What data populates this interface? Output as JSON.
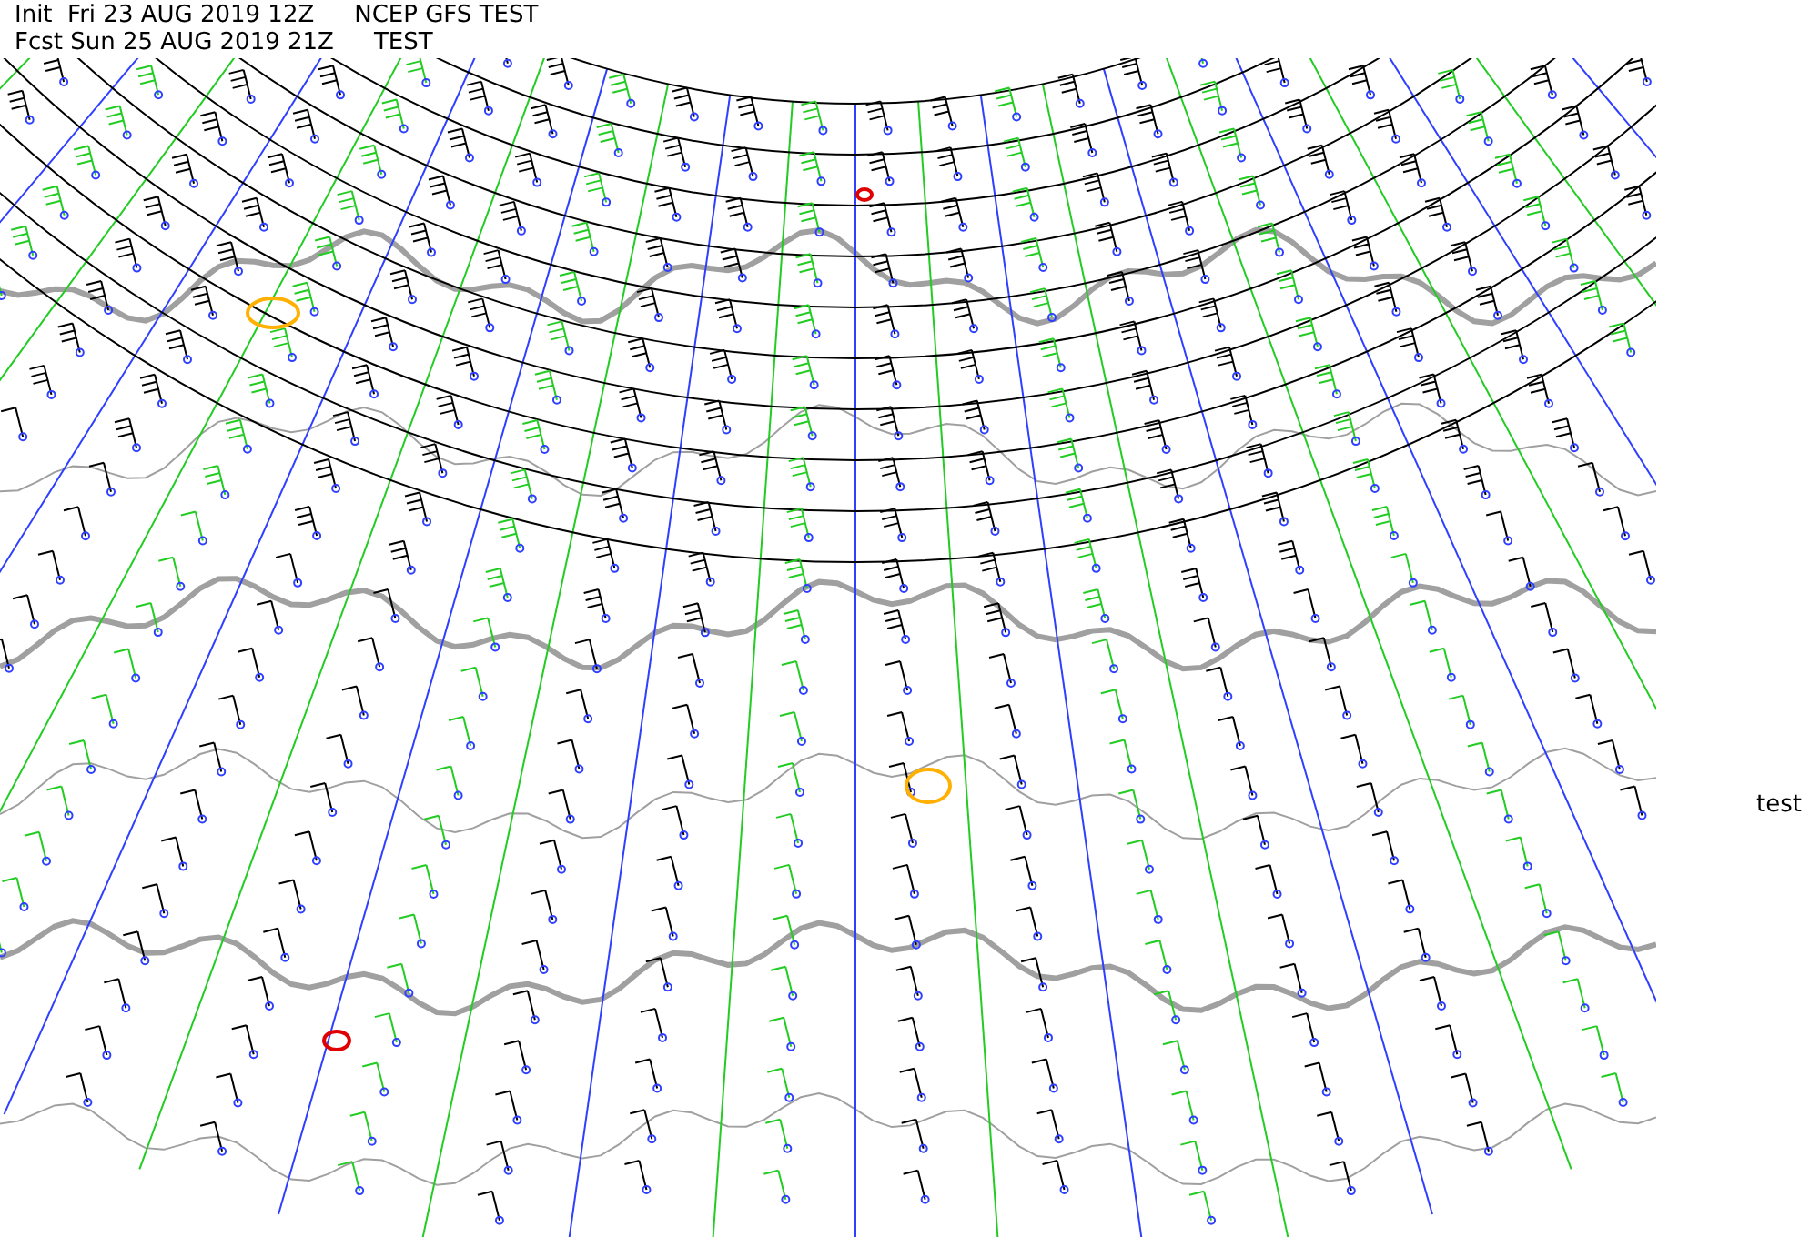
{
  "header": {
    "lines": [
      {
        "parts": [
          "Init  Fri 23 AUG 2019 12Z",
          "NCEP GFS TEST"
        ]
      },
      {
        "parts": [
          "Fcst Sun 25 AUG 2019 21Z",
          "TEST"
        ]
      }
    ]
  },
  "side_label": "test"
}
